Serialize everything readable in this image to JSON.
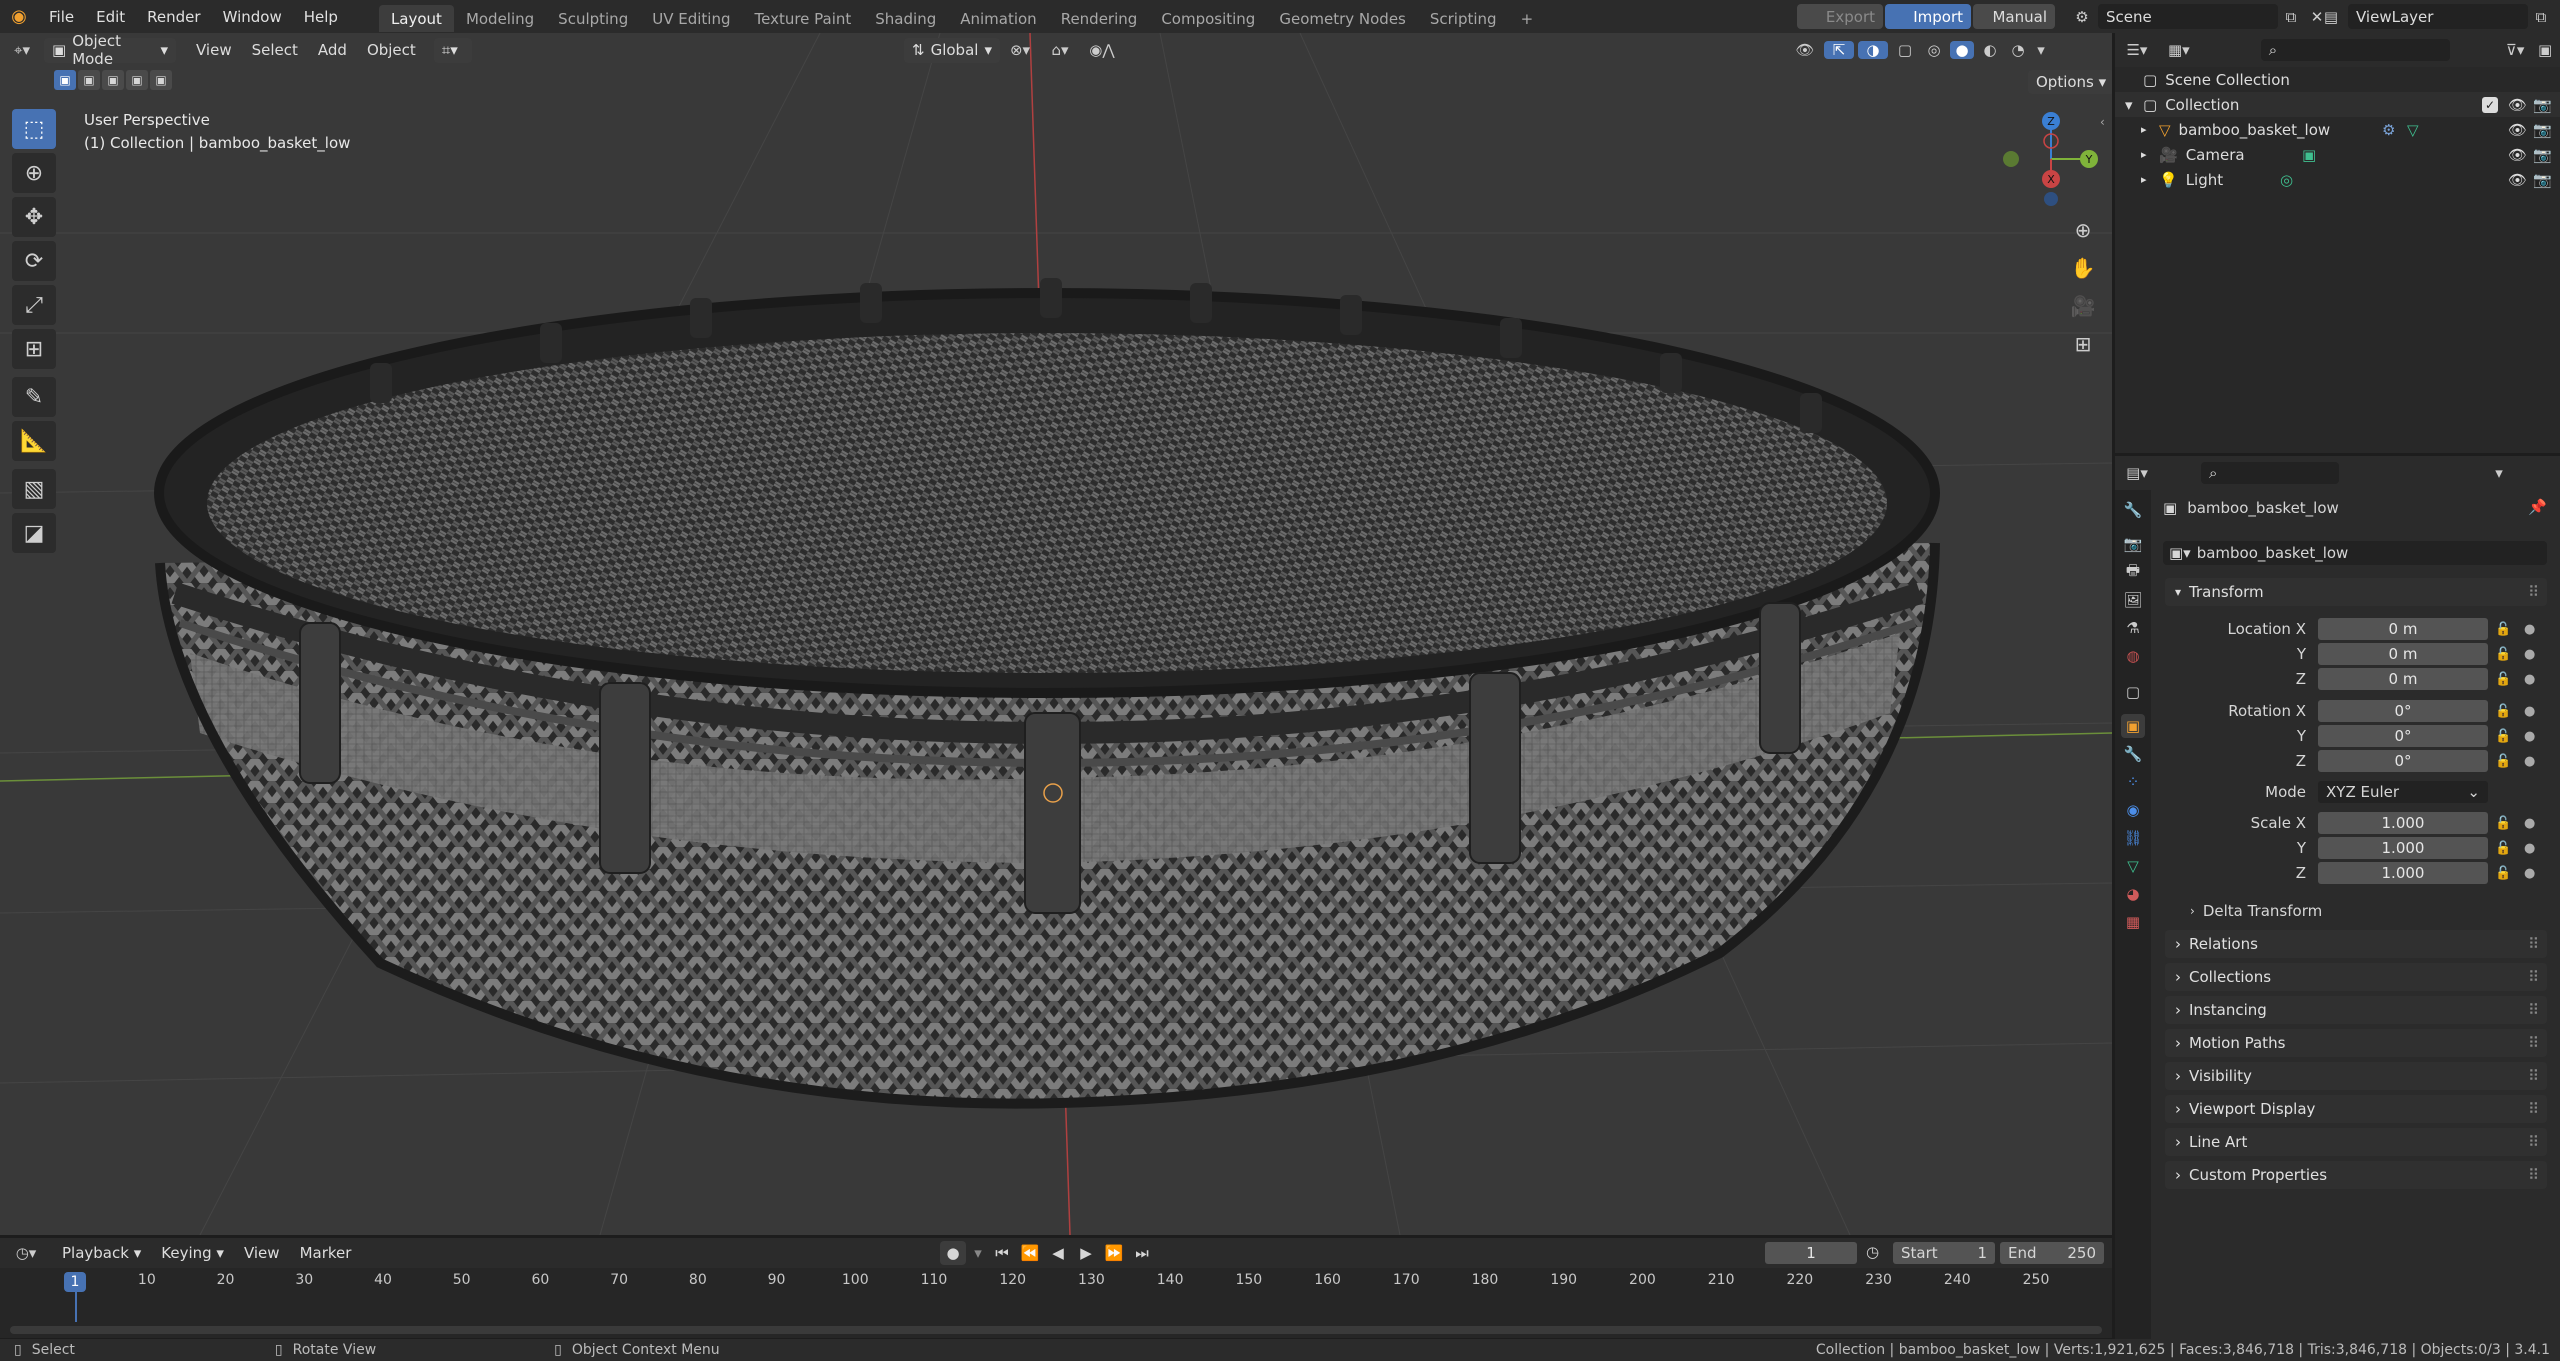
{
  "topbar": {
    "menus": [
      "File",
      "Edit",
      "Render",
      "Window",
      "Help"
    ],
    "workspaces": [
      "Layout",
      "Modeling",
      "Sculpting",
      "UV Editing",
      "Texture Paint",
      "Shading",
      "Animation",
      "Rendering",
      "Compositing",
      "Geometry Nodes",
      "Scripting"
    ],
    "add_workspace": "+",
    "export_label": "Export",
    "import_label": "Import",
    "manual_label": "Manual",
    "scene_name": "Scene",
    "viewlayer_name": "ViewLayer"
  },
  "viewport": {
    "mode": "Object Mode",
    "menus": [
      "View",
      "Select",
      "Add",
      "Object"
    ],
    "orientation": "Global",
    "options_label": "Options",
    "overlay_line1": "User Perspective",
    "overlay_line2": "(1) Collection | bamboo_basket_low",
    "gizmo_labels": {
      "z": "Z",
      "y": "Y",
      "x": "X"
    }
  },
  "outliner": {
    "search_placeholder": "",
    "root": "Scene Collection",
    "collection": "Collection",
    "items": [
      {
        "name": "bamboo_basket_low",
        "icon": "mesh-icon"
      },
      {
        "name": "Camera",
        "icon": "camera-icon"
      },
      {
        "name": "Light",
        "icon": "light-icon"
      }
    ]
  },
  "properties": {
    "object_name": "bamboo_basket_low",
    "datablock_name": "bamboo_basket_low",
    "transform_label": "Transform",
    "location_x_label": "Location X",
    "location_x": "0 m",
    "location_y_label": "Y",
    "location_y": "0 m",
    "location_z_label": "Z",
    "location_z": "0 m",
    "rotation_x_label": "Rotation X",
    "rotation_x": "0°",
    "rotation_y_label": "Y",
    "rotation_y": "0°",
    "rotation_z_label": "Z",
    "rotation_z": "0°",
    "mode_label": "Mode",
    "mode_value": "XYZ Euler",
    "scale_x_label": "Scale X",
    "scale_x": "1.000",
    "scale_y_label": "Y",
    "scale_y": "1.000",
    "scale_z_label": "Z",
    "scale_z": "1.000",
    "delta_label": "Delta Transform",
    "sections": [
      "Relations",
      "Collections",
      "Instancing",
      "Motion Paths",
      "Visibility",
      "Viewport Display",
      "Line Art",
      "Custom Properties"
    ]
  },
  "timeline": {
    "menus": [
      "Playback",
      "Keying",
      "View",
      "Marker"
    ],
    "current_frame": "1",
    "start_label": "Start",
    "start": "1",
    "end_label": "End",
    "end": "250",
    "ticks": [
      "1",
      "10",
      "20",
      "30",
      "40",
      "50",
      "60",
      "70",
      "80",
      "90",
      "100",
      "110",
      "120",
      "130",
      "140",
      "150",
      "160",
      "170",
      "180",
      "190",
      "200",
      "210",
      "220",
      "230",
      "240",
      "250"
    ]
  },
  "statusbar": {
    "select": "Select",
    "rotate": "Rotate View",
    "context": "Object Context Menu",
    "stats": "Collection | bamboo_basket_low | Verts:1,921,625 | Faces:3,846,718 | Tris:3,846,718 | Objects:0/3 | 3.4.1"
  },
  "colors": {
    "accent": "#4772b3",
    "viewport_bg": "#393939",
    "axis_x": "#c94444",
    "axis_y": "#7fb33a",
    "axis_z": "#3a7fd4"
  }
}
